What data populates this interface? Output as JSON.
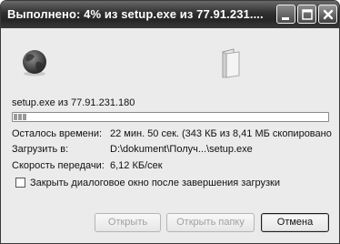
{
  "window": {
    "title": "Выполнено: 4% из setup.exe из 77.91.231...."
  },
  "download": {
    "source": "setup.exe из 77.91.231.180",
    "progress_percent": 4,
    "time_left_label": "Осталось времени:",
    "time_left_value": "22 мин. 50 сек. (343 КБ из 8,41 МБ скопировано",
    "download_to_label": "Загрузить в:",
    "download_to_value": "D:\\dokument\\Получ...\\setup.exe",
    "speed_label": "Скорость передачи:",
    "speed_value": "6,12 КБ/сек",
    "close_checkbox_label": "Закрыть диалоговое окно после завершения загрузки",
    "close_checkbox_checked": false
  },
  "buttons": {
    "open": "Открыть",
    "open_folder": "Открыть папку",
    "cancel": "Отмена"
  },
  "icons": {
    "source": "globe-icon",
    "destination": "folder-icon"
  }
}
